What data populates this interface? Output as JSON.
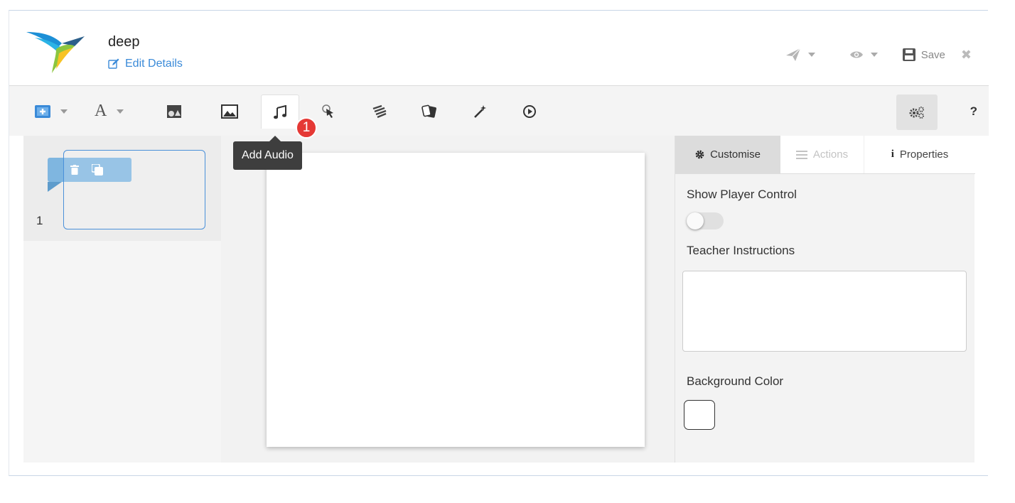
{
  "header": {
    "title": "deep",
    "edit_details": "Edit Details",
    "save_label": "Save"
  },
  "toolbar": {
    "tooltip": "Add Audio",
    "notification_count": "1",
    "help_label": "?",
    "font_label": "A"
  },
  "slides": {
    "items": [
      {
        "number": "1"
      }
    ]
  },
  "panel": {
    "tabs": [
      {
        "label": "Customise",
        "icon": "gear-icon"
      },
      {
        "label": "Actions",
        "icon": "list-icon"
      },
      {
        "label": "Properties",
        "icon": "info-icon"
      }
    ],
    "show_player_control_label": "Show Player Control",
    "show_player_control_value": false,
    "teacher_instructions_label": "Teacher Instructions",
    "teacher_instructions_value": "",
    "background_color_label": "Background Color",
    "background_color_value": "#ffffff"
  },
  "colors": {
    "accent": "#3a8ad8",
    "badge": "#e53935",
    "slide_ribbon": "#7fb6e0"
  }
}
